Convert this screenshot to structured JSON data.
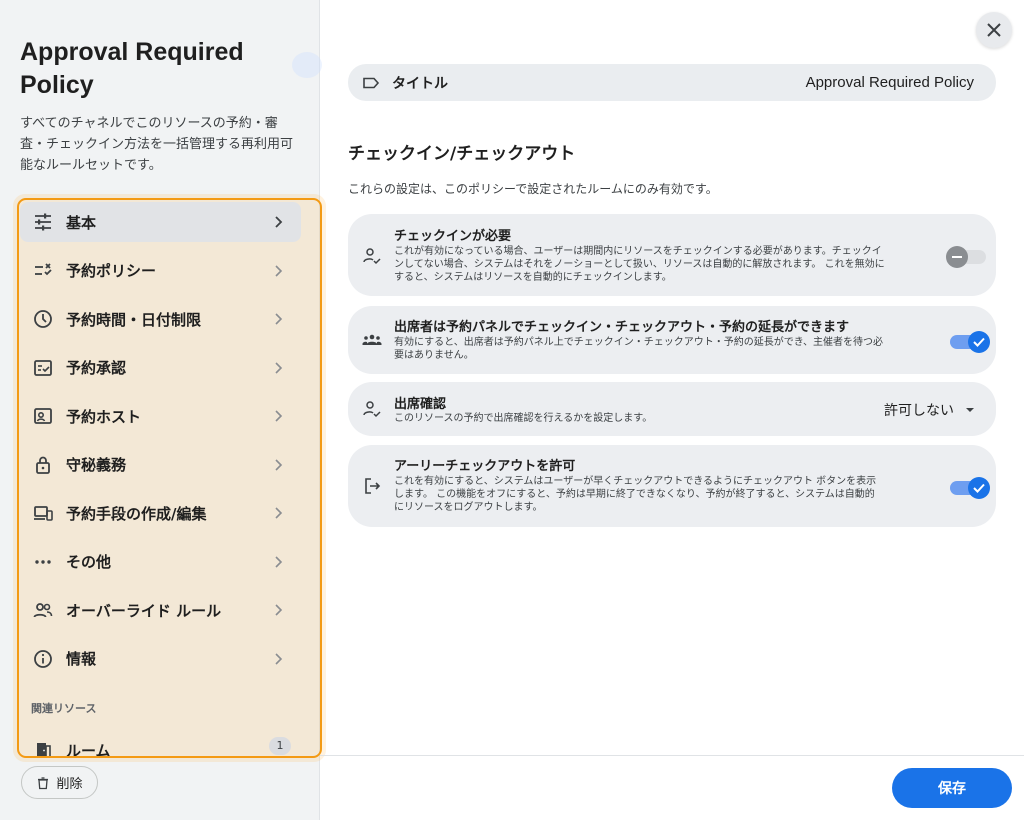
{
  "left": {
    "title": "Approval Required Policy",
    "description": "すべてのチャネルでこのリソースの予約・審査・チェックイン方法を一括管理する再利用可能なルールセットです。",
    "nav": [
      {
        "label": "基本",
        "icon": "tune-icon"
      },
      {
        "label": "予約ポリシー",
        "icon": "checklist-icon"
      },
      {
        "label": "予約時間・日付制限",
        "icon": "clock-icon"
      },
      {
        "label": "予約承認",
        "icon": "approval-icon"
      },
      {
        "label": "予約ホスト",
        "icon": "host-icon"
      },
      {
        "label": "守秘義務",
        "icon": "lock-icon"
      },
      {
        "label": "予約手段の作成/編集",
        "icon": "devices-icon"
      },
      {
        "label": "その他",
        "icon": "more-icon"
      },
      {
        "label": "オーバーライド ルール",
        "icon": "people-icon"
      },
      {
        "label": "情報",
        "icon": "info-icon"
      }
    ],
    "related_label": "関連リソース",
    "room": {
      "label": "ルーム",
      "count": "1"
    },
    "delete_label": "削除"
  },
  "main": {
    "title_field": {
      "label": "タイトル",
      "value": "Approval Required Policy"
    },
    "section_heading": "チェックイン/チェックアウト",
    "section_sub": "これらの設定は、このポリシーで設定されたルームにのみ有効です。",
    "cards": [
      {
        "title": "チェックインが必要",
        "desc": [
          "これが有効になっている場合、ユーザーは期間内にリソースをチェックインする必要があります。チェックイ",
          "ンしてない場合、システムはそれをノーショーとして扱い、リソースは自動的に解放されます。 これを無効に",
          "すると、システムはリソースを自動的にチェックインします。"
        ],
        "toggle": "off"
      },
      {
        "title": "出席者は予約パネルでチェックイン・チェックアウト・予約の延長ができます",
        "desc": [
          "有効にすると、出席者は予約パネル上でチェックイン・チェックアウト・予約の延長ができ、主催者を待つ必",
          "要はありません。"
        ],
        "toggle": "on"
      },
      {
        "title": "出席確認",
        "desc": [
          "このリソースの予約で出席確認を行えるかを設定します。"
        ],
        "select_value": "許可しない"
      },
      {
        "title": "アーリーチェックアウトを許可",
        "desc": [
          "これを有効にすると、システムはユーザーが早くチェックアウトできるようにチェックアウト ボタンを表示",
          "します。 この機能をオフにすると、予約は早期に終了できなくなり、予約が終了すると、システムは自動的",
          "にリソースをログアウトします。"
        ],
        "toggle": "on"
      }
    ],
    "save_label": "保存"
  },
  "colors": {
    "accent": "#1a73e8",
    "highlight": "#f39a14"
  }
}
